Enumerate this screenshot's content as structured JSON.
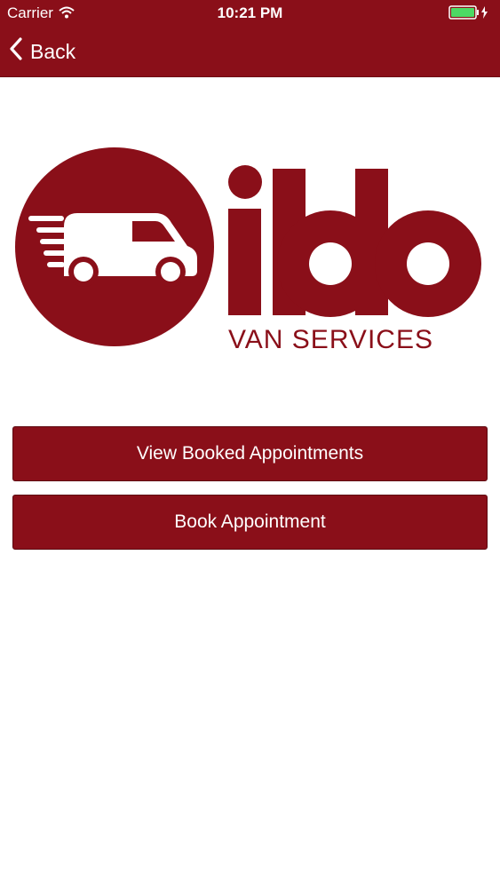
{
  "status_bar": {
    "carrier": "Carrier",
    "time": "10:21 PM",
    "wifi_icon": "wifi-icon",
    "battery_icon": "battery-charging-icon"
  },
  "nav": {
    "back_label": "Back",
    "back_icon": "chevron-left-icon"
  },
  "logo": {
    "brand": "ibb",
    "tagline": "VAN SERVICES",
    "icon": "van-icon"
  },
  "actions": {
    "view_booked_label": "View Booked Appointments",
    "book_label": "Book Appointment"
  },
  "colors": {
    "brand": "#8a0f19",
    "background": "#ffffff",
    "battery": "#4cd964"
  }
}
